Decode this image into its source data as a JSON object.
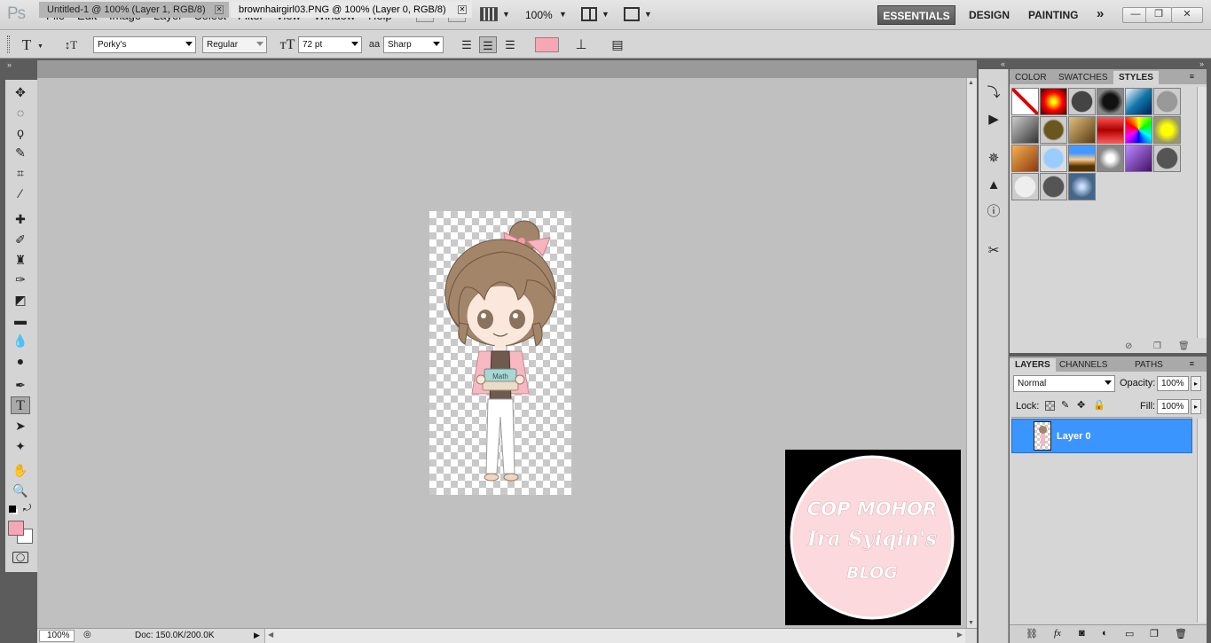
{
  "app": {
    "logo": "Ps"
  },
  "menu": [
    "File",
    "Edit",
    "Image",
    "Layer",
    "Select",
    "Filter",
    "View",
    "Window",
    "Help"
  ],
  "app_bar": {
    "bridge_label": "Br",
    "minibridge_label": "Mb",
    "zoom": "100%"
  },
  "workspaces": {
    "essentials": "ESSENTIALS",
    "design": "DESIGN",
    "painting": "PAINTING",
    "more": "»"
  },
  "window_controls": {
    "minimize": "—",
    "restore": "❐",
    "close": "✕"
  },
  "options": {
    "font_family": "Porky's",
    "font_style": "Regular",
    "font_size": "72 pt",
    "aa_label": "aa",
    "antialias": "Sharp",
    "text_color": "#f7a7b3"
  },
  "tabs": [
    {
      "label": "Untitled-1 @ 100% (Layer 1, RGB/8)"
    },
    {
      "label": "brownhairgirl03.PNG @ 100% (Layer 0, RGB/8)"
    }
  ],
  "status": {
    "zoom": "100%",
    "doc": "Doc: 150.0K/200.0K"
  },
  "watermark": {
    "line1": "COP MOHOR",
    "line2": "Ira Syiqin's",
    "line3": "BLOG"
  },
  "artwork": {
    "book_label": "Math"
  },
  "styles_panel": {
    "tabs": [
      "COLOR",
      "SWATCHES",
      "STYLES"
    ],
    "active_tab": "STYLES"
  },
  "layers_panel": {
    "tabs": [
      "LAYERS",
      "CHANNELS",
      "PATHS"
    ],
    "blend_mode": "Normal",
    "opacity_label": "Opacity:",
    "opacity": "100%",
    "lock_label": "Lock:",
    "fill_label": "Fill:",
    "fill": "100%",
    "layer_name": "Layer 0"
  },
  "colors": {
    "foreground": "#f7a7b3",
    "background": "#ffffff",
    "selection": "#3a95ff",
    "watermark_circle": "#fbd9dd"
  }
}
